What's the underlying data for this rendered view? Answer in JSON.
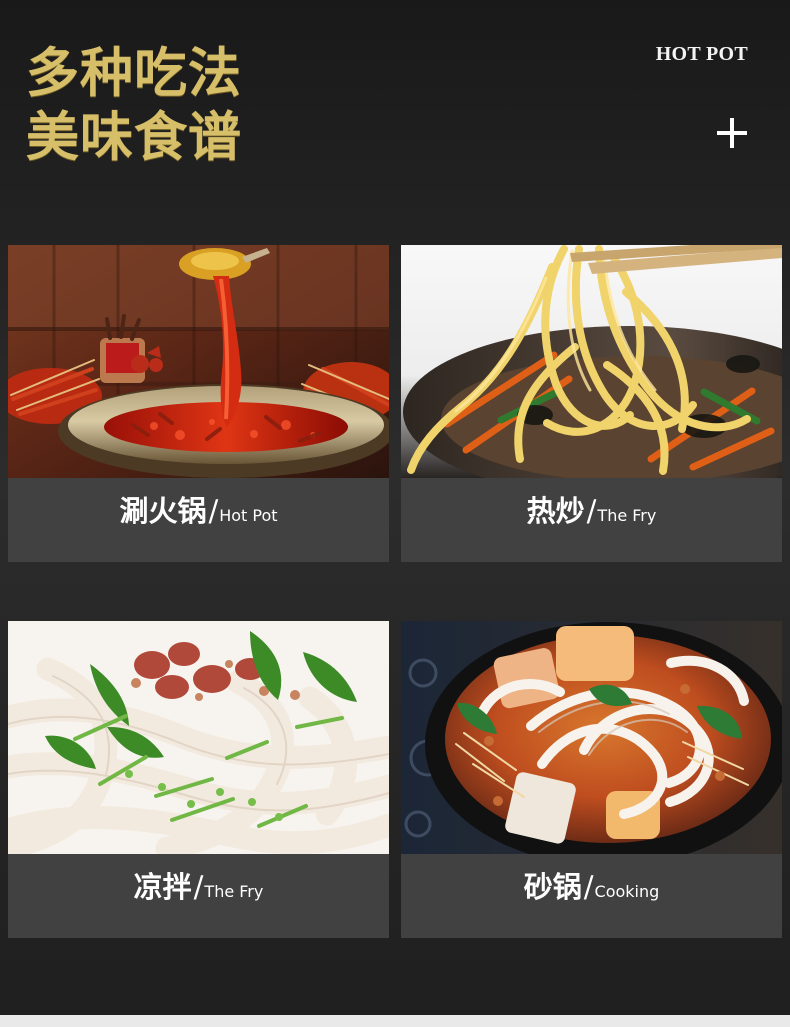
{
  "header": {
    "title_line_1": "多种吃法",
    "title_line_2": "美味食谱",
    "brand": "HOT POT",
    "plus_icon": "plus-icon"
  },
  "colors": {
    "title_gold": "#d7bf6a",
    "card_background": "#414141",
    "page_background": "#242424",
    "text_white": "#ffffff"
  },
  "cards": [
    {
      "name_zh": "涮火锅",
      "slash": "/",
      "name_en": "Hot Pot",
      "image": "hot-pot-photo"
    },
    {
      "name_zh": "热炒",
      "slash": "/",
      "name_en": "The Fry",
      "image": "stir-fried-noodles-photo"
    },
    {
      "name_zh": "凉拌",
      "slash": "/",
      "name_en": "The Fry",
      "image": "cold-noodles-photo"
    },
    {
      "name_zh": "砂锅",
      "slash": "/",
      "name_en": "Cooking",
      "image": "clay-pot-noodles-photo"
    }
  ]
}
